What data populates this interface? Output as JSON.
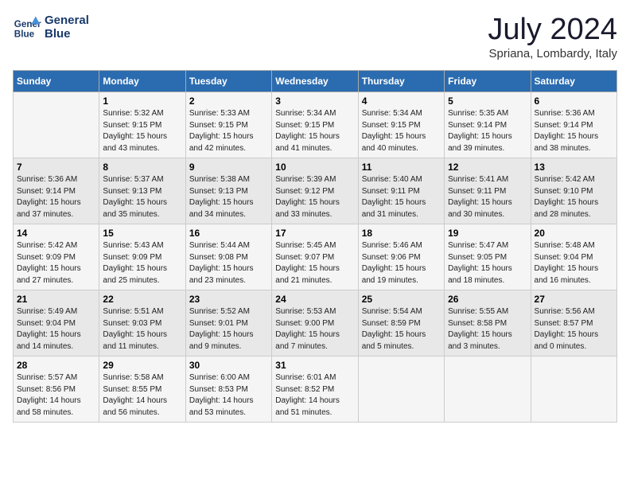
{
  "logo": {
    "name": "General",
    "name2": "Blue"
  },
  "header": {
    "month": "July 2024",
    "location": "Spriana, Lombardy, Italy"
  },
  "columns": [
    "Sunday",
    "Monday",
    "Tuesday",
    "Wednesday",
    "Thursday",
    "Friday",
    "Saturday"
  ],
  "weeks": [
    [
      {
        "day": "",
        "info": ""
      },
      {
        "day": "1",
        "info": "Sunrise: 5:32 AM\nSunset: 9:15 PM\nDaylight: 15 hours\nand 43 minutes."
      },
      {
        "day": "2",
        "info": "Sunrise: 5:33 AM\nSunset: 9:15 PM\nDaylight: 15 hours\nand 42 minutes."
      },
      {
        "day": "3",
        "info": "Sunrise: 5:34 AM\nSunset: 9:15 PM\nDaylight: 15 hours\nand 41 minutes."
      },
      {
        "day": "4",
        "info": "Sunrise: 5:34 AM\nSunset: 9:15 PM\nDaylight: 15 hours\nand 40 minutes."
      },
      {
        "day": "5",
        "info": "Sunrise: 5:35 AM\nSunset: 9:14 PM\nDaylight: 15 hours\nand 39 minutes."
      },
      {
        "day": "6",
        "info": "Sunrise: 5:36 AM\nSunset: 9:14 PM\nDaylight: 15 hours\nand 38 minutes."
      }
    ],
    [
      {
        "day": "7",
        "info": "Sunrise: 5:36 AM\nSunset: 9:14 PM\nDaylight: 15 hours\nand 37 minutes."
      },
      {
        "day": "8",
        "info": "Sunrise: 5:37 AM\nSunset: 9:13 PM\nDaylight: 15 hours\nand 35 minutes."
      },
      {
        "day": "9",
        "info": "Sunrise: 5:38 AM\nSunset: 9:13 PM\nDaylight: 15 hours\nand 34 minutes."
      },
      {
        "day": "10",
        "info": "Sunrise: 5:39 AM\nSunset: 9:12 PM\nDaylight: 15 hours\nand 33 minutes."
      },
      {
        "day": "11",
        "info": "Sunrise: 5:40 AM\nSunset: 9:11 PM\nDaylight: 15 hours\nand 31 minutes."
      },
      {
        "day": "12",
        "info": "Sunrise: 5:41 AM\nSunset: 9:11 PM\nDaylight: 15 hours\nand 30 minutes."
      },
      {
        "day": "13",
        "info": "Sunrise: 5:42 AM\nSunset: 9:10 PM\nDaylight: 15 hours\nand 28 minutes."
      }
    ],
    [
      {
        "day": "14",
        "info": "Sunrise: 5:42 AM\nSunset: 9:09 PM\nDaylight: 15 hours\nand 27 minutes."
      },
      {
        "day": "15",
        "info": "Sunrise: 5:43 AM\nSunset: 9:09 PM\nDaylight: 15 hours\nand 25 minutes."
      },
      {
        "day": "16",
        "info": "Sunrise: 5:44 AM\nSunset: 9:08 PM\nDaylight: 15 hours\nand 23 minutes."
      },
      {
        "day": "17",
        "info": "Sunrise: 5:45 AM\nSunset: 9:07 PM\nDaylight: 15 hours\nand 21 minutes."
      },
      {
        "day": "18",
        "info": "Sunrise: 5:46 AM\nSunset: 9:06 PM\nDaylight: 15 hours\nand 19 minutes."
      },
      {
        "day": "19",
        "info": "Sunrise: 5:47 AM\nSunset: 9:05 PM\nDaylight: 15 hours\nand 18 minutes."
      },
      {
        "day": "20",
        "info": "Sunrise: 5:48 AM\nSunset: 9:04 PM\nDaylight: 15 hours\nand 16 minutes."
      }
    ],
    [
      {
        "day": "21",
        "info": "Sunrise: 5:49 AM\nSunset: 9:04 PM\nDaylight: 15 hours\nand 14 minutes."
      },
      {
        "day": "22",
        "info": "Sunrise: 5:51 AM\nSunset: 9:03 PM\nDaylight: 15 hours\nand 11 minutes."
      },
      {
        "day": "23",
        "info": "Sunrise: 5:52 AM\nSunset: 9:01 PM\nDaylight: 15 hours\nand 9 minutes."
      },
      {
        "day": "24",
        "info": "Sunrise: 5:53 AM\nSunset: 9:00 PM\nDaylight: 15 hours\nand 7 minutes."
      },
      {
        "day": "25",
        "info": "Sunrise: 5:54 AM\nSunset: 8:59 PM\nDaylight: 15 hours\nand 5 minutes."
      },
      {
        "day": "26",
        "info": "Sunrise: 5:55 AM\nSunset: 8:58 PM\nDaylight: 15 hours\nand 3 minutes."
      },
      {
        "day": "27",
        "info": "Sunrise: 5:56 AM\nSunset: 8:57 PM\nDaylight: 15 hours\nand 0 minutes."
      }
    ],
    [
      {
        "day": "28",
        "info": "Sunrise: 5:57 AM\nSunset: 8:56 PM\nDaylight: 14 hours\nand 58 minutes."
      },
      {
        "day": "29",
        "info": "Sunrise: 5:58 AM\nSunset: 8:55 PM\nDaylight: 14 hours\nand 56 minutes."
      },
      {
        "day": "30",
        "info": "Sunrise: 6:00 AM\nSunset: 8:53 PM\nDaylight: 14 hours\nand 53 minutes."
      },
      {
        "day": "31",
        "info": "Sunrise: 6:01 AM\nSunset: 8:52 PM\nDaylight: 14 hours\nand 51 minutes."
      },
      {
        "day": "",
        "info": ""
      },
      {
        "day": "",
        "info": ""
      },
      {
        "day": "",
        "info": ""
      }
    ]
  ]
}
